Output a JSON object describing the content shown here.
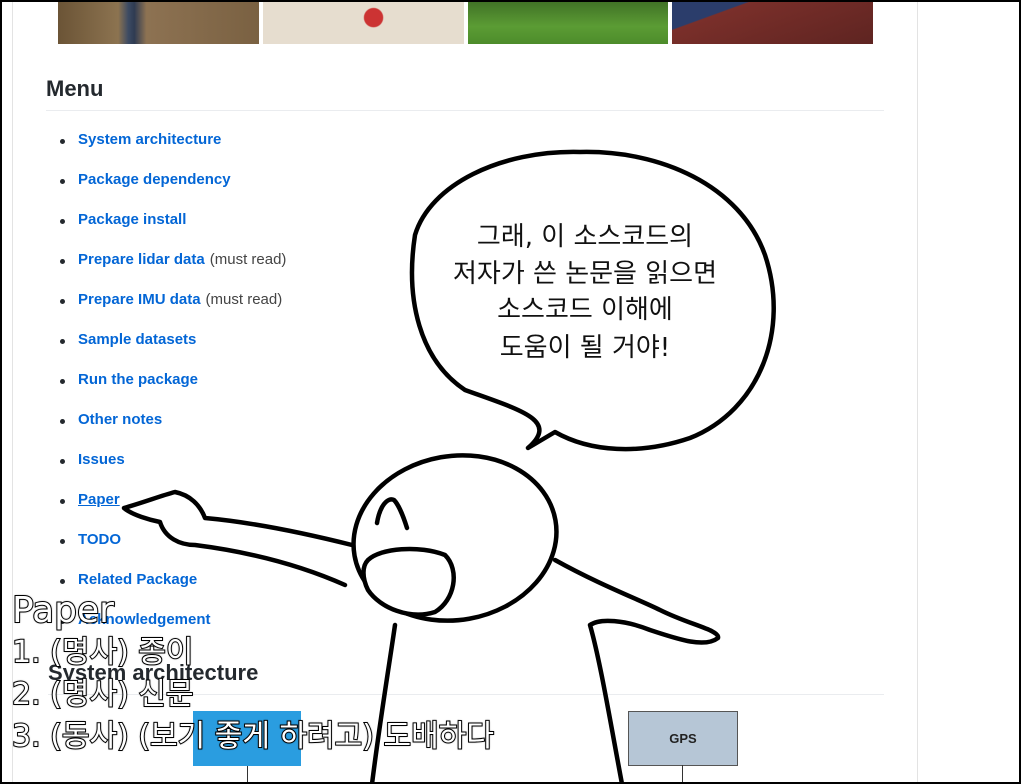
{
  "menu": {
    "title": "Menu",
    "items": [
      {
        "label": "System architecture",
        "note": ""
      },
      {
        "label": "Package dependency",
        "note": ""
      },
      {
        "label": "Package install",
        "note": ""
      },
      {
        "label": "Prepare lidar data",
        "note": "(must read)"
      },
      {
        "label": "Prepare IMU data",
        "note": "(must read)"
      },
      {
        "label": "Sample datasets",
        "note": ""
      },
      {
        "label": "Run the package",
        "note": ""
      },
      {
        "label": "Other notes",
        "note": ""
      },
      {
        "label": "Issues",
        "note": ""
      },
      {
        "label": "Paper",
        "note": ""
      },
      {
        "label": "TODO",
        "note": ""
      },
      {
        "label": "Related Package",
        "note": ""
      },
      {
        "label": "Acknowledgement",
        "note": ""
      }
    ]
  },
  "section": {
    "title": "System architecture"
  },
  "diagram": {
    "gps_label": "GPS"
  },
  "speech": {
    "line1": "그래, 이 소스코드의",
    "line2": "저자가 쓴 논문을 읽으면",
    "line3": "소스코드 이해에",
    "line4": "도움이 될 거야!"
  },
  "caption": {
    "title": "Paper",
    "line1": "1. (명사) 종이",
    "line2": "2. (명사) 신문",
    "line3": "3. (동사) (보기 좋게 하려고) 도배하다"
  },
  "colors": {
    "link": "#0366d6",
    "heading": "#24292e",
    "gps_box": "#b6c6d6",
    "blue_box": "#2a9de0"
  }
}
